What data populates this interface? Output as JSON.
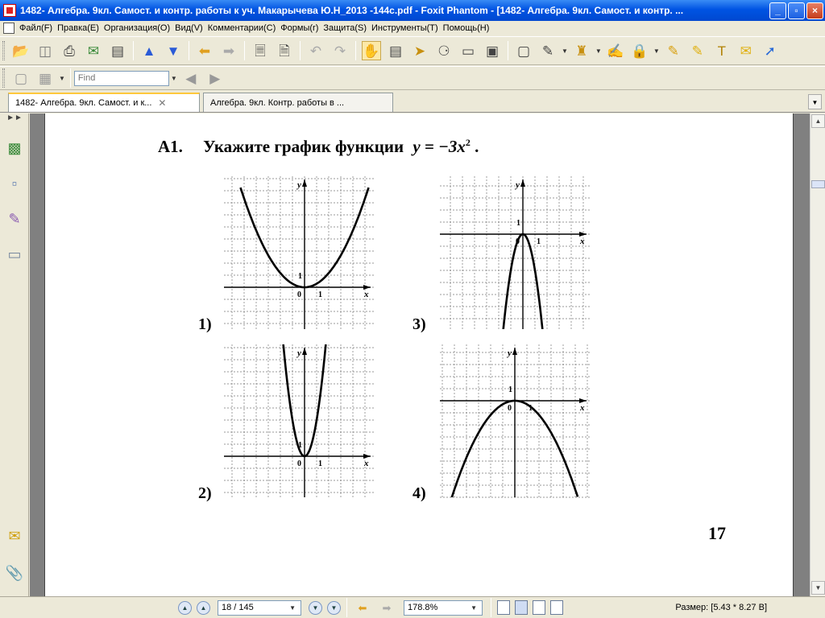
{
  "window": {
    "title": "1482- Алгебра. 9кл. Самост. и контр. работы к уч. Макарычева Ю.Н_2013 -144с.pdf - Foxit Phantom - [1482- Алгебра. 9кл. Самост. и контр. ...",
    "min_label": "_",
    "max_label": "▫",
    "close_label": "×"
  },
  "menu": [
    "Файл(F)",
    "Правка(E)",
    "Организация(O)",
    "Вид(V)",
    "Комментарии(C)",
    "Формы(r)",
    "Защита(S)",
    "Инструменты(T)",
    "Помощь(H)"
  ],
  "toolbar": {
    "icons": [
      "open-icon",
      "save-icon",
      "print-icon",
      "email-icon",
      "scan-icon",
      "page-up-icon",
      "page-down-icon",
      "back-icon",
      "forward-icon",
      "extract-pages-icon",
      "insert-pages-icon",
      "undo-icon",
      "redo-icon",
      "hand-tool-icon",
      "select-text-icon",
      "pointer-icon",
      "binoculars-icon",
      "text-box-icon",
      "image-icon",
      "rectangle-icon",
      "edit-icon",
      "stamp-icon",
      "signature-icon",
      "lock-icon",
      "note-icon",
      "highlight-icon",
      "typewriter-icon",
      "comment-icon",
      "arrow-tool-icon"
    ],
    "find_placeholder": "Find"
  },
  "tabs": [
    {
      "label": "1482- Алгебра. 9кл. Самост. и к...",
      "active": true
    },
    {
      "label": "Алгебра. 9кл. Контр. работы в ...",
      "active": false
    }
  ],
  "document": {
    "question_number": "А1.",
    "question_text": "Укажите график функции",
    "function_text": "y = −3x",
    "exponent": "2",
    "period": ".",
    "graphs": [
      {
        "label": "1)",
        "curve": "y = x²/4 + ... (wide upward parabola)",
        "axis_x": "x",
        "axis_y": "y",
        "origin": "0",
        "tick_x": "1",
        "tick_y": "1"
      },
      {
        "label": "2)",
        "axis_x": "x",
        "axis_y": "y",
        "origin": "0",
        "tick_x": "1",
        "tick_y": "1"
      },
      {
        "label": "3)",
        "axis_x": "x",
        "axis_y": "y",
        "origin": "0",
        "tick_x": "1",
        "tick_y": "1"
      },
      {
        "label": "4)",
        "axis_x": "x",
        "axis_y": "y",
        "origin": "0",
        "tick_x": "1",
        "tick_y": "1"
      }
    ],
    "page_number": "17"
  },
  "status": {
    "page_value": "18 / 145",
    "zoom_value": "178.8%",
    "size_text": "Размер: [5.43 * 8.27 B]"
  }
}
